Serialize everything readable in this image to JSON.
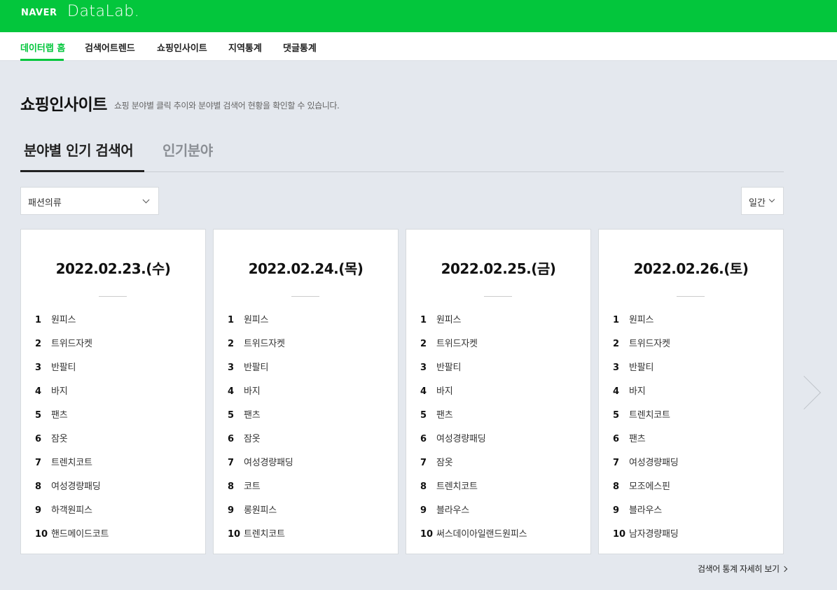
{
  "header": {
    "brand": "NAVER",
    "product": "DataLab."
  },
  "nav": {
    "items": [
      {
        "label": "데이터랩 홈",
        "active": true
      },
      {
        "label": "검색어트렌드",
        "active": false
      },
      {
        "label": "쇼핑인사이트",
        "active": false
      },
      {
        "label": "지역통계",
        "active": false
      },
      {
        "label": "댓글통계",
        "active": false
      }
    ]
  },
  "page": {
    "title": "쇼핑인사이트",
    "description": "쇼핑 분야별 클릭 추이와 분야별 검색어 현황을 확인할 수 있습니다."
  },
  "tabs": [
    {
      "label": "분야별 인기 검색어",
      "active": true
    },
    {
      "label": "인기분야",
      "active": false
    }
  ],
  "filters": {
    "category": "패션의류",
    "period": "일간"
  },
  "colors": {
    "brand_green": "#03c63c"
  },
  "cards": [
    {
      "date": "2022.02.23.(수)",
      "ranks": [
        {
          "num": "1",
          "keyword": "원피스"
        },
        {
          "num": "2",
          "keyword": "트위드자켓"
        },
        {
          "num": "3",
          "keyword": "반팔티"
        },
        {
          "num": "4",
          "keyword": "바지"
        },
        {
          "num": "5",
          "keyword": "팬츠"
        },
        {
          "num": "6",
          "keyword": "잠옷"
        },
        {
          "num": "7",
          "keyword": "트렌치코트"
        },
        {
          "num": "8",
          "keyword": "여성경량패딩"
        },
        {
          "num": "9",
          "keyword": "하객원피스"
        },
        {
          "num": "10",
          "keyword": "핸드메이드코트"
        }
      ]
    },
    {
      "date": "2022.02.24.(목)",
      "ranks": [
        {
          "num": "1",
          "keyword": "원피스"
        },
        {
          "num": "2",
          "keyword": "트위드자켓"
        },
        {
          "num": "3",
          "keyword": "반팔티"
        },
        {
          "num": "4",
          "keyword": "바지"
        },
        {
          "num": "5",
          "keyword": "팬츠"
        },
        {
          "num": "6",
          "keyword": "잠옷"
        },
        {
          "num": "7",
          "keyword": "여성경량패딩"
        },
        {
          "num": "8",
          "keyword": "코트"
        },
        {
          "num": "9",
          "keyword": "롱원피스"
        },
        {
          "num": "10",
          "keyword": "트렌치코트"
        }
      ]
    },
    {
      "date": "2022.02.25.(금)",
      "ranks": [
        {
          "num": "1",
          "keyword": "원피스"
        },
        {
          "num": "2",
          "keyword": "트위드자켓"
        },
        {
          "num": "3",
          "keyword": "반팔티"
        },
        {
          "num": "4",
          "keyword": "바지"
        },
        {
          "num": "5",
          "keyword": "팬츠"
        },
        {
          "num": "6",
          "keyword": "여성경량패딩"
        },
        {
          "num": "7",
          "keyword": "잠옷"
        },
        {
          "num": "8",
          "keyword": "트렌치코트"
        },
        {
          "num": "9",
          "keyword": "블라우스"
        },
        {
          "num": "10",
          "keyword": "써스데이아일랜드원피스"
        }
      ]
    },
    {
      "date": "2022.02.26.(토)",
      "ranks": [
        {
          "num": "1",
          "keyword": "원피스"
        },
        {
          "num": "2",
          "keyword": "트위드자켓"
        },
        {
          "num": "3",
          "keyword": "반팔티"
        },
        {
          "num": "4",
          "keyword": "바지"
        },
        {
          "num": "5",
          "keyword": "트렌치코트"
        },
        {
          "num": "6",
          "keyword": "팬츠"
        },
        {
          "num": "7",
          "keyword": "여성경량패딩"
        },
        {
          "num": "8",
          "keyword": "모조에스핀"
        },
        {
          "num": "9",
          "keyword": "블라우스"
        },
        {
          "num": "10",
          "keyword": "남자경량패딩"
        }
      ]
    }
  ],
  "footer": {
    "more_link": "검색어 통계 자세히 보기"
  }
}
